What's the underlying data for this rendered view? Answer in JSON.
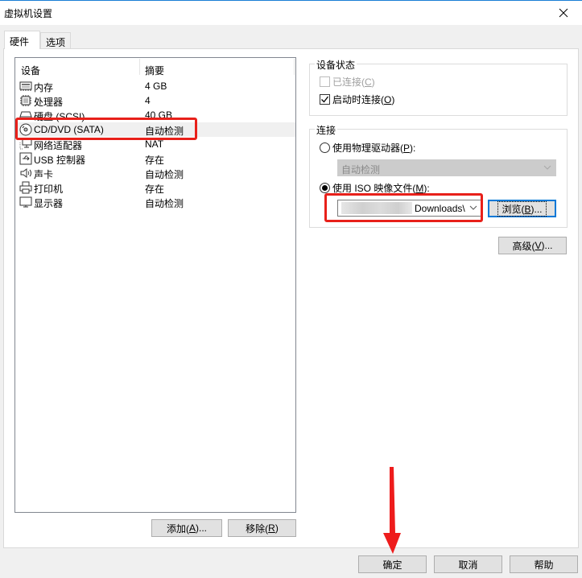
{
  "window": {
    "title": "虚拟机设置",
    "close_icon": "close-icon"
  },
  "tabs": [
    {
      "label": "硬件",
      "active": true
    },
    {
      "label": "选项",
      "active": false
    }
  ],
  "device_list": {
    "columns": [
      "设备",
      "摘要"
    ],
    "rows": [
      {
        "icon": "memory-icon",
        "name": "内存",
        "summary": "4 GB"
      },
      {
        "icon": "processor-icon",
        "name": "处理器",
        "summary": "4"
      },
      {
        "icon": "hard-disk-icon",
        "name": "硬盘 (SCSI)",
        "summary": "40 GB"
      },
      {
        "icon": "cd-dvd-icon",
        "name": "CD/DVD (SATA)",
        "summary": "自动检测",
        "selected": true
      },
      {
        "icon": "network-adapter-icon",
        "name": "网络适配器",
        "summary": "NAT"
      },
      {
        "icon": "usb-controller-icon",
        "name": "USB 控制器",
        "summary": "存在"
      },
      {
        "icon": "sound-card-icon",
        "name": "声卡",
        "summary": "自动检测"
      },
      {
        "icon": "printer-icon",
        "name": "打印机",
        "summary": "存在"
      },
      {
        "icon": "display-icon",
        "name": "显示器",
        "summary": "自动检测"
      }
    ],
    "add_button": {
      "text": "添加(",
      "key": "A",
      "suffix": ")..."
    },
    "remove_button": {
      "text": "移除(",
      "key": "R",
      "suffix": ")"
    }
  },
  "device_status": {
    "title": "设备状态",
    "connected": {
      "text": "已连接(",
      "key": "C",
      "suffix": ")",
      "checked": false,
      "disabled": true
    },
    "connect_at_power_on": {
      "text": "启动时连接(",
      "key": "O",
      "suffix": ")",
      "checked": true,
      "disabled": false
    }
  },
  "connection": {
    "title": "连接",
    "physical_drive": {
      "text": "使用物理驱动器(",
      "key": "P",
      "suffix": "):",
      "selected": false
    },
    "physical_drive_combo": {
      "value": "自动检测",
      "disabled": true
    },
    "iso_image": {
      "text": "使用 ISO 映像文件(",
      "key": "M",
      "suffix": "):",
      "selected": true
    },
    "iso_path": {
      "value": "Downloads\\"
    },
    "browse_button": {
      "text": "浏览(",
      "key": "B",
      "suffix": ")..."
    }
  },
  "advanced_button": {
    "text": "高级(",
    "key": "V",
    "suffix": ")..."
  },
  "footer": {
    "ok": "确定",
    "cancel": "取消",
    "help": "帮助"
  },
  "annotations": {
    "highlight_color": "#e8201a"
  }
}
